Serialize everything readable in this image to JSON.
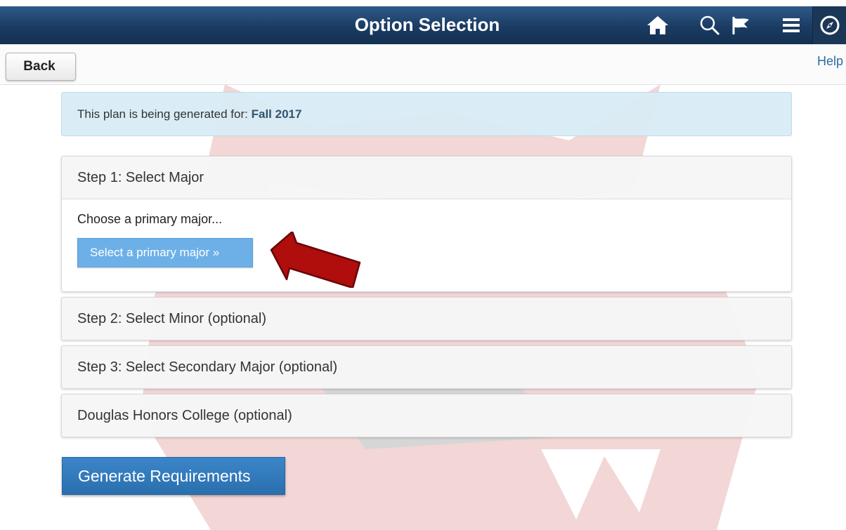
{
  "header": {
    "title": "Option Selection",
    "icons": [
      "home-icon",
      "search-icon",
      "flag-icon",
      "menu-icon",
      "nav-bar-compass-icon"
    ]
  },
  "toolbar": {
    "back_label": "Back",
    "help_label": "Help"
  },
  "banner": {
    "prefix": "This plan is being generated for:",
    "term": "Fall 2017"
  },
  "steps": [
    {
      "title": "Step 1: Select Major",
      "prompt": "Choose a primary major...",
      "button_label": "Select a primary major »",
      "expanded": true
    },
    {
      "title": "Step 2: Select Minor (optional)",
      "expanded": false
    },
    {
      "title": "Step 3: Select Secondary Major (optional)",
      "expanded": false
    },
    {
      "title": "Douglas Honors College (optional)",
      "expanded": false
    }
  ],
  "actions": {
    "generate_label": "Generate Requirements"
  },
  "colors": {
    "header": "#1f4570",
    "banner": "#d8ecf6",
    "primary_button": "#2e75b6",
    "secondary_button": "#6db0e8",
    "annotation_arrow": "#b00d0d"
  }
}
